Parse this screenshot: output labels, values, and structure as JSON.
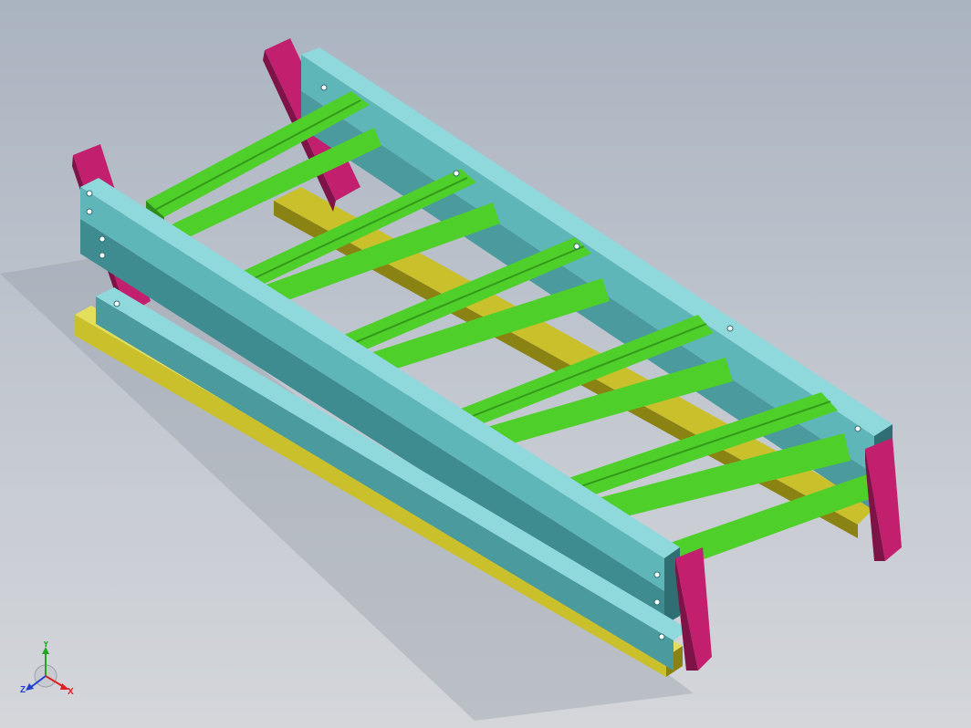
{
  "viewport": {
    "background_top": "#aab3c0",
    "background_bottom": "#d4d6da"
  },
  "model": {
    "parts": [
      {
        "name": "side-rail",
        "color": "#5fb6b8",
        "dark": "#2f6f73",
        "light": "#8fd9dc"
      },
      {
        "name": "roller",
        "color": "#4fcf2a",
        "dark": "#2d8d18",
        "light": "#8df062"
      },
      {
        "name": "support-leg",
        "color": "#c2206f",
        "dark": "#7d1347",
        "light": "#e0569a"
      },
      {
        "name": "base-beam",
        "color": "#c9c02c",
        "dark": "#8a8212",
        "light": "#e4de5d"
      }
    ]
  },
  "triad": {
    "x_label": "X",
    "y_label": "Y",
    "z_label": "Z",
    "x_color": "#e02020",
    "y_color": "#1fa81f",
    "z_color": "#2040d0"
  }
}
